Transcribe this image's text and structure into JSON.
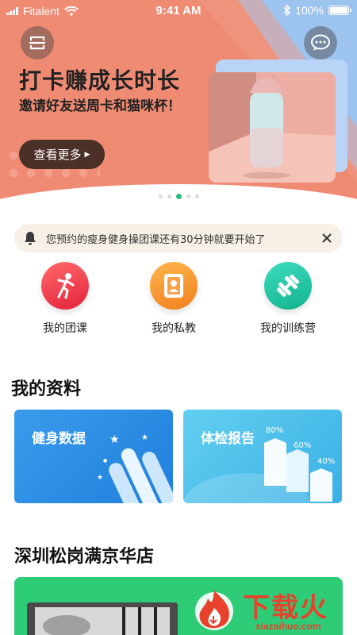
{
  "status_bar": {
    "carrier": "Fitalent",
    "time": "9:41 AM",
    "battery": "100%"
  },
  "banner": {
    "title": "打卡赚成长时长",
    "subtitle": "邀请好友送周卡和猫咪杯！",
    "button_label": "查看更多",
    "page_count": 5,
    "active_page": 3
  },
  "notice": {
    "text": "您预约的瘦身健身操团课还有30分钟就要开始了"
  },
  "quick_actions": [
    {
      "label": "我的团课",
      "icon": "runner-icon",
      "color": "#ef3b45"
    },
    {
      "label": "我的私教",
      "icon": "trainer-badge-icon",
      "color": "#f4982e"
    },
    {
      "label": "我的训练营",
      "icon": "dumbbell-icon",
      "color": "#21c29d"
    }
  ],
  "profile_section": {
    "title": "我的资料",
    "cards": [
      {
        "title": "健身数据",
        "color": "#2f8fe6"
      },
      {
        "title": "体检报告",
        "color": "#4cc4ec",
        "bars": [
          "80%",
          "60%",
          "40%"
        ]
      }
    ]
  },
  "store_section": {
    "title": "深圳松岗满京华店",
    "card_color": "#2fcc77"
  },
  "watermark": {
    "text": "下载火",
    "url": "xiazaihuo.com"
  }
}
